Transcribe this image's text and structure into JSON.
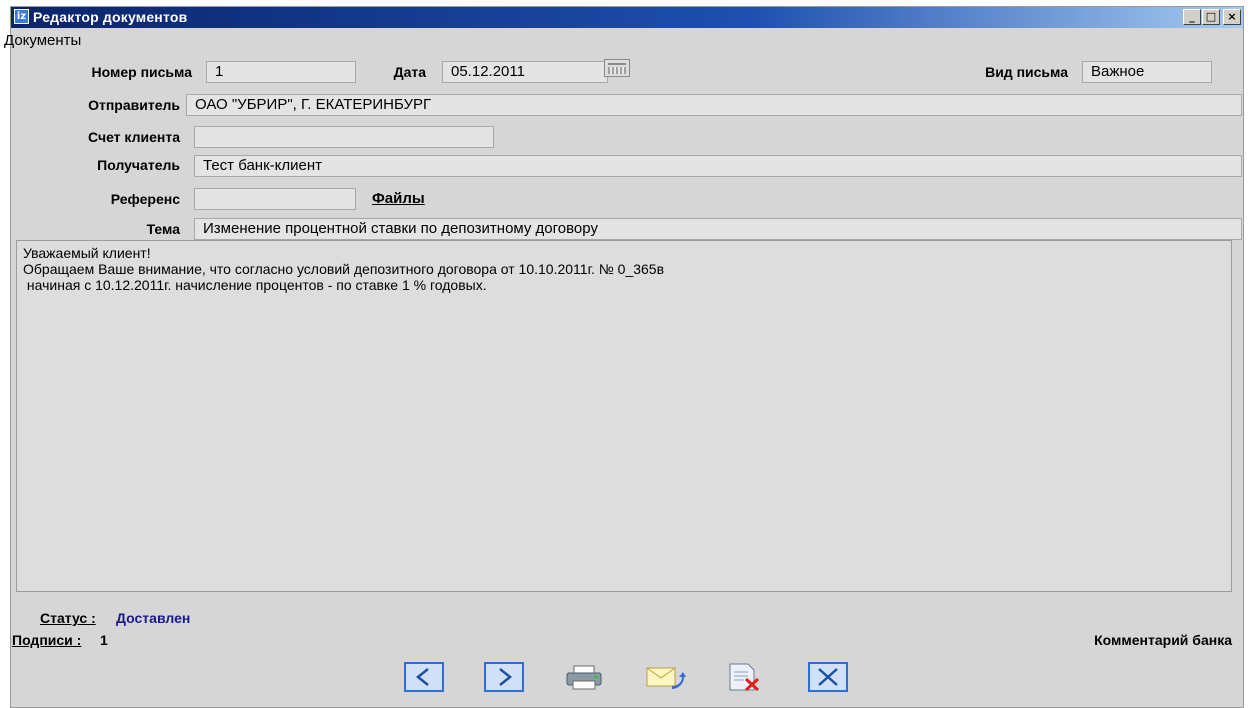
{
  "window": {
    "title": "Редактор документов"
  },
  "menu": {
    "documents": "Документы"
  },
  "form": {
    "letter_number_label": "Номер письма",
    "letter_number": "1",
    "date_label": "Дата",
    "date": "05.12.2011",
    "letter_type_label": "Вид письма",
    "letter_type": "Важное",
    "sender_label": "Отправитель",
    "sender": "ОАО \"УБРИР\", Г. ЕКАТЕРИНБУРГ",
    "client_account_label": "Счет клиента",
    "client_account": "",
    "recipient_label": "Получатель",
    "recipient": "Тест банк-клиент",
    "reference_label": "Референс",
    "reference": "",
    "files_link": "Файлы",
    "subject_label": "Тема",
    "subject": "Изменение процентной ставки по депозитному договору"
  },
  "body": {
    "lines": [
      "Уважаемый клиент!",
      "Обращаем Ваше внимание, что согласно условий депозитного договора от 10.10.2011г. № 0_365в",
      " начиная с 10.12.2011г. начисление процентов - по ставке 1 % годовых."
    ]
  },
  "footer": {
    "status_label": "Статус :",
    "status_value": "Доставлен",
    "signatures_label": "Подписи :",
    "signatures_value": "1",
    "bank_comment": "Комментарий банка"
  },
  "toolbar": {
    "icons": [
      "prev-arrow-icon",
      "next-arrow-icon",
      "printer-icon",
      "envelope-reply-icon",
      "delete-document-icon",
      "close-x-icon"
    ]
  },
  "colors": {
    "title_bar": "#0a246a",
    "status": "#1a1a8c",
    "nav_button": "#2f6fd4",
    "window_bg": "#d6d6d6"
  }
}
